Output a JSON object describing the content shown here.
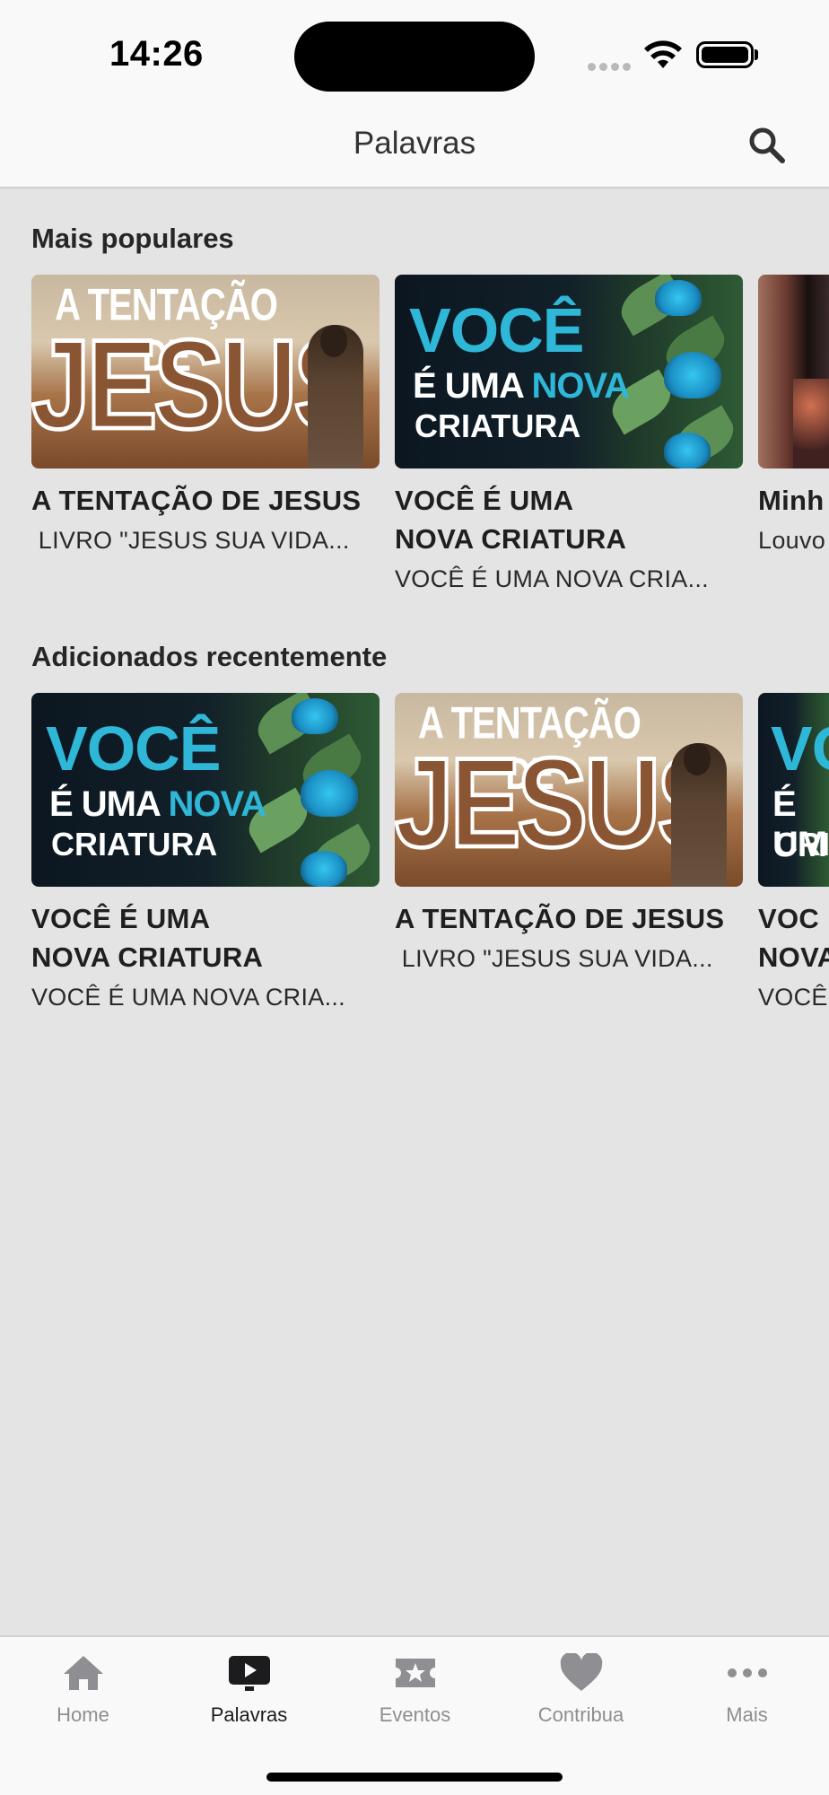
{
  "status": {
    "time": "14:26"
  },
  "header": {
    "title": "Palavras",
    "search_icon": "search-icon"
  },
  "sections": [
    {
      "title": "Mais populares",
      "cards": [
        {
          "title_line1": "A TENTAÇÃO DE JESUS",
          "title_line2": "",
          "subtitle": " LIVRO \"JESUS SUA VIDA...",
          "thumb_line1": "A TENTAÇÃO DE",
          "thumb_line2": "JESUS"
        },
        {
          "title_line1": "VOCÊ É UMA",
          "title_line2": "NOVA CRIATURA",
          "subtitle": "VOCÊ É UMA NOVA CRIA...",
          "thumb_line1": "VOCÊ",
          "thumb_line2a": "É UMA ",
          "thumb_line2b": "NOVA",
          "thumb_line3": "CRIATURA"
        },
        {
          "title_line1": "Minh",
          "title_line2": "",
          "subtitle": "Louvo"
        }
      ]
    },
    {
      "title": "Adicionados recentemente",
      "cards": [
        {
          "title_line1": "VOCÊ É UMA",
          "title_line2": "NOVA CRIATURA",
          "subtitle": "VOCÊ É UMA NOVA CRIA...",
          "thumb_line1": "VOCÊ",
          "thumb_line2a": "É UMA ",
          "thumb_line2b": "NOVA",
          "thumb_line3": "CRIATURA"
        },
        {
          "title_line1": "A TENTAÇÃO DE JESUS",
          "title_line2": "",
          "subtitle": " LIVRO \"JESUS SUA VIDA...",
          "thumb_line1": "A TENTAÇÃO DE",
          "thumb_line2": "JESUS"
        },
        {
          "title_line1": "VOC",
          "title_line2": "NOVA",
          "subtitle": "VOCÊ",
          "thumb_line1": "VO",
          "thumb_line2a": "É UM",
          "thumb_line3": "CRI"
        }
      ]
    }
  ],
  "tabs": [
    {
      "label": "Home",
      "icon": "home-icon",
      "active": false
    },
    {
      "label": "Palavras",
      "icon": "play-icon",
      "active": true
    },
    {
      "label": "Eventos",
      "icon": "ticket-icon",
      "active": false
    },
    {
      "label": "Contribua",
      "icon": "heart-icon",
      "active": false
    },
    {
      "label": "Mais",
      "icon": "more-icon",
      "active": false
    }
  ],
  "colors": {
    "background": "#e4e4e4",
    "bar": "#f9f9f9",
    "accent_cyan": "#2fb7d8",
    "tab_inactive": "#8e8e93",
    "tab_active": "#1c1c1e"
  }
}
